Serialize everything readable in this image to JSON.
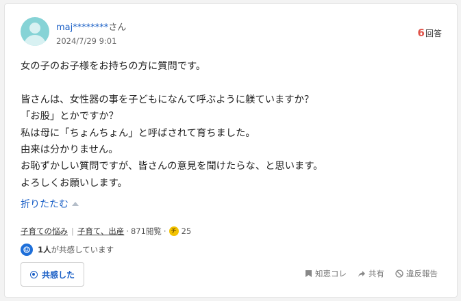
{
  "question": {
    "user_name": "maj********",
    "user_suffix": "さん",
    "date": "2024/7/29 9:01",
    "answer_count": "6",
    "answer_label": "回答",
    "body_lines": [
      "女の子のお子様をお持ちの方に質問です。",
      "",
      "皆さんは、女性器の事を子どもになんて呼ぶように躾ていますか？",
      "「お股」とかですか？",
      "私は母に「ちょんちょん」と呼ばされて育ちました。",
      "由来は分かりません。",
      "お恥ずかしい質問ですが、皆さんの意見を聞けたらな、と思います。",
      "よろしくお願いします。"
    ],
    "fold_label": "折りたたむ"
  },
  "meta": {
    "category1": "子育ての悩み",
    "separator": "|",
    "category2": "子育て、出産",
    "views": "871閲覧",
    "coin_symbol": "チ",
    "coins": "25"
  },
  "empathy": {
    "count": "1人",
    "text": "が共感しています",
    "button_label": "共感した"
  },
  "actions": {
    "chiebukuro": "知恵コレ",
    "share": "共有",
    "report": "違反報告"
  },
  "colors": {
    "link_blue": "#1a5fc6",
    "accent_red": "#e0534a",
    "avatar_teal": "#86d3d6",
    "coin_yellow": "#f3c200"
  }
}
